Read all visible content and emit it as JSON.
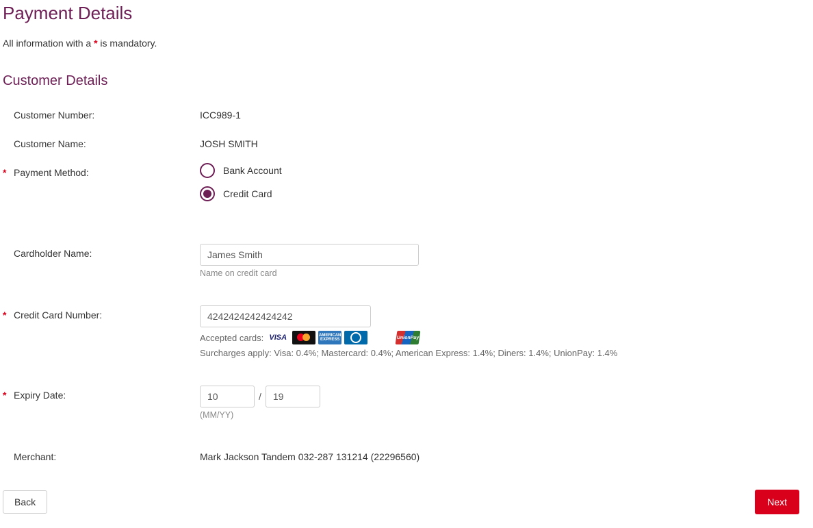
{
  "page_title": "Payment Details",
  "mandatory_prefix": "All information with a ",
  "mandatory_marker": "*",
  "mandatory_suffix": " is mandatory.",
  "section_customer": "Customer Details",
  "labels": {
    "customer_number": "Customer Number:",
    "customer_name": "Customer Name:",
    "payment_method": "Payment Method:",
    "cardholder_name": "Cardholder Name:",
    "credit_card_number": "Credit Card Number:",
    "expiry_date": "Expiry Date:",
    "merchant": "Merchant:"
  },
  "values": {
    "customer_number": "ICC989-1",
    "customer_name": "JOSH SMITH",
    "cardholder_name": "James Smith",
    "credit_card_number": "4242424242424242",
    "expiry_mm": "10",
    "expiry_yy": "19",
    "merchant": "Mark Jackson Tandem 032-287 131214 (22296560)"
  },
  "payment_method": {
    "options": [
      {
        "label": "Bank Account",
        "selected": false
      },
      {
        "label": "Credit Card",
        "selected": true
      }
    ]
  },
  "hints": {
    "cardholder": "Name on credit card",
    "accepted_prefix": "Accepted cards:",
    "surcharges": "Surcharges apply: Visa: 0.4%; Mastercard: 0.4%; American Express: 1.4%; Diners: 1.4%; UnionPay: 1.4%",
    "expiry_format": "(MM/YY)"
  },
  "card_icons": {
    "visa": "VISA",
    "amex": "AMERICAN EXPRESS",
    "unionpay": "UnionPay"
  },
  "buttons": {
    "back": "Back",
    "next": "Next"
  }
}
